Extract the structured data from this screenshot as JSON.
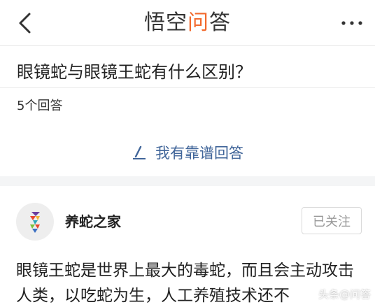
{
  "header": {
    "logo_text_start": "悟空",
    "logo_text_accent": "问",
    "logo_text_end": "答"
  },
  "question": {
    "title": "眼镜蛇与眼镜王蛇有什么区别？",
    "answer_count": "5个回答",
    "write_answer_label": "我有靠谱回答"
  },
  "answer": {
    "author_name": "养蛇之家",
    "follow_label": "已关注",
    "content": "眼镜王蛇是世界上最大的毒蛇，而且会主动攻击人类，以吃蛇为生，人工养殖技术还不"
  },
  "watermark": {
    "text": "头条@问答"
  },
  "colors": {
    "link_blue": "#406599",
    "logo_orange": "#f26a2e",
    "divider": "#ececec",
    "section_gap": "#f4f5f6"
  },
  "icons": [
    "back-arrow-icon",
    "more-icon",
    "pen-icon",
    "avatar-logo-icon"
  ]
}
